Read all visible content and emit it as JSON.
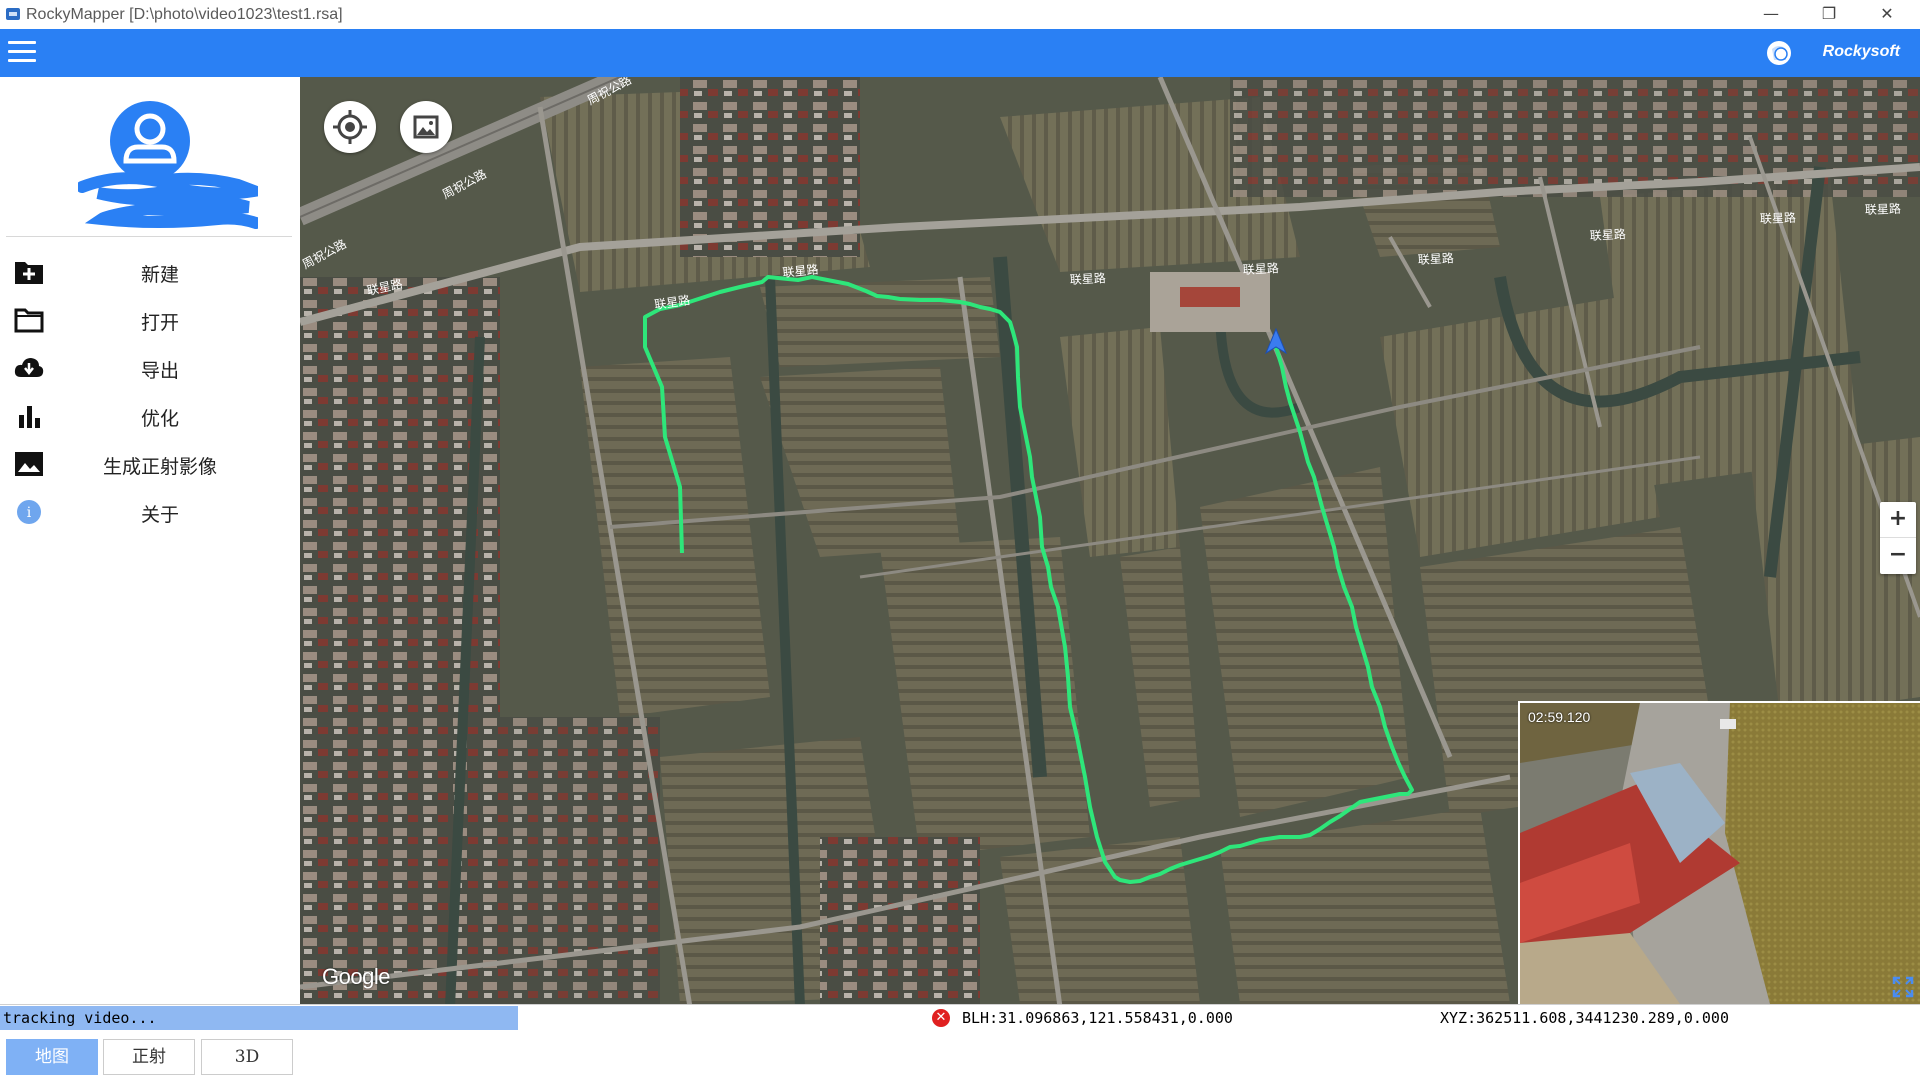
{
  "window": {
    "title": "RockyMapper [D:\\photo\\video1023\\test1.rsa]",
    "minimize": "—",
    "restore": "❐",
    "close": "✕"
  },
  "header": {
    "brand": "Rockysoft",
    "accent_color": "#2a80f4"
  },
  "sidebar": {
    "items": [
      {
        "label": "新建",
        "icon": "add-folder-icon"
      },
      {
        "label": "打开",
        "icon": "folder-icon"
      },
      {
        "label": "导出",
        "icon": "cloud-download-icon"
      },
      {
        "label": "优化",
        "icon": "bar-chart-icon"
      },
      {
        "label": "生成正射影像",
        "icon": "image-icon"
      },
      {
        "label": "关于",
        "icon": "info-icon"
      }
    ],
    "view_tabs": [
      {
        "label": "地图",
        "active": true
      },
      {
        "label": "正射",
        "active": false
      },
      {
        "label": "3D",
        "active": false
      }
    ]
  },
  "map": {
    "attribution": "Google",
    "road_labels": [
      "周祝公路",
      "周祝公路",
      "周祝公路",
      "联星路",
      "联星路",
      "联星路",
      "联星路",
      "联星路",
      "联星路",
      "联星路",
      "联星路",
      "联星路"
    ],
    "track_color": "#2ee67a",
    "zoom_in": "+",
    "zoom_out": "−"
  },
  "video": {
    "timestamp": "02:59.120"
  },
  "status": {
    "message": "tracking video...",
    "blh": "BLH:31.096863,121.558431,0.000",
    "xyz": "XYZ:362511.608,3441230.289,0.000"
  }
}
